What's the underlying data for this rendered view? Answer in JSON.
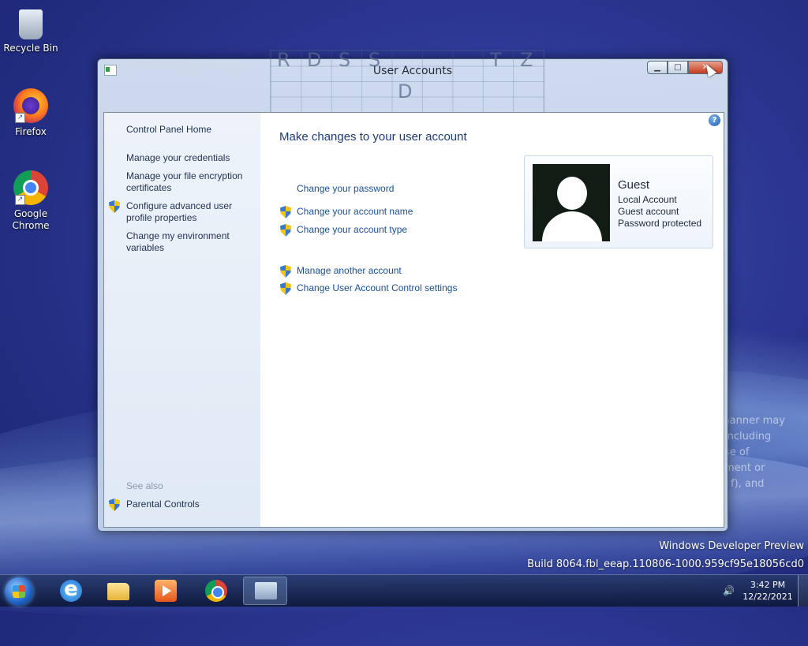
{
  "desktop": {
    "icons": [
      {
        "label": "Recycle Bin",
        "icon": "recycle-bin-icon"
      },
      {
        "label": "Firefox",
        "icon": "firefox-icon"
      },
      {
        "label": "Google Chrome",
        "icon": "chrome-icon"
      }
    ],
    "legal_fragments": [
      "manner may",
      "including",
      "se of",
      "ment or",
      "f), and"
    ],
    "watermark": {
      "line1": "Windows Developer Preview",
      "line2": "Build 8064.fbl_eeap.110806-1000.959cf95e18056cd0"
    }
  },
  "overlay": {
    "letters_top": [
      "R",
      "D",
      "S",
      "S",
      "T",
      "Z"
    ],
    "letter_bottom": "D"
  },
  "window": {
    "title": "User Accounts",
    "minimize_glyph": "▁",
    "maximize_glyph": "□",
    "close_glyph": "✕",
    "help_glyph": "?",
    "left_pane": {
      "home": "Control Panel Home",
      "links": [
        {
          "label": "Manage your credentials"
        },
        {
          "label": "Manage your file encryption certificates"
        },
        {
          "label": "Configure advanced user profile properties",
          "shield": true
        },
        {
          "label": "Change my environment variables"
        }
      ],
      "see_also": "See also",
      "see_also_links": [
        {
          "label": "Parental Controls",
          "shield": true
        }
      ]
    },
    "main": {
      "heading": "Make changes to your user account",
      "tasks": [
        {
          "label": "Change your password",
          "shield": false
        },
        {
          "label": "Change your account name",
          "shield": true
        },
        {
          "label": "Change your account type",
          "shield": true
        },
        {
          "label": "Manage another account",
          "shield": true
        },
        {
          "label": "Change User Account Control settings",
          "shield": true
        }
      ]
    },
    "user_card": {
      "name": "Guest",
      "details": [
        "Local Account",
        "Guest account",
        "Password protected"
      ]
    }
  },
  "taskbar": {
    "pinned": [
      "internet-explorer-icon",
      "file-explorer-icon",
      "media-player-icon",
      "chrome-icon",
      "active-window-icon"
    ],
    "clock": {
      "time": "3:42 PM",
      "date": "12/22/2021"
    },
    "speaker_glyph": "🔊"
  },
  "colors": {
    "link": "#1a4f9c",
    "heading": "#1e3a7a",
    "desktop": "#2a3690"
  }
}
